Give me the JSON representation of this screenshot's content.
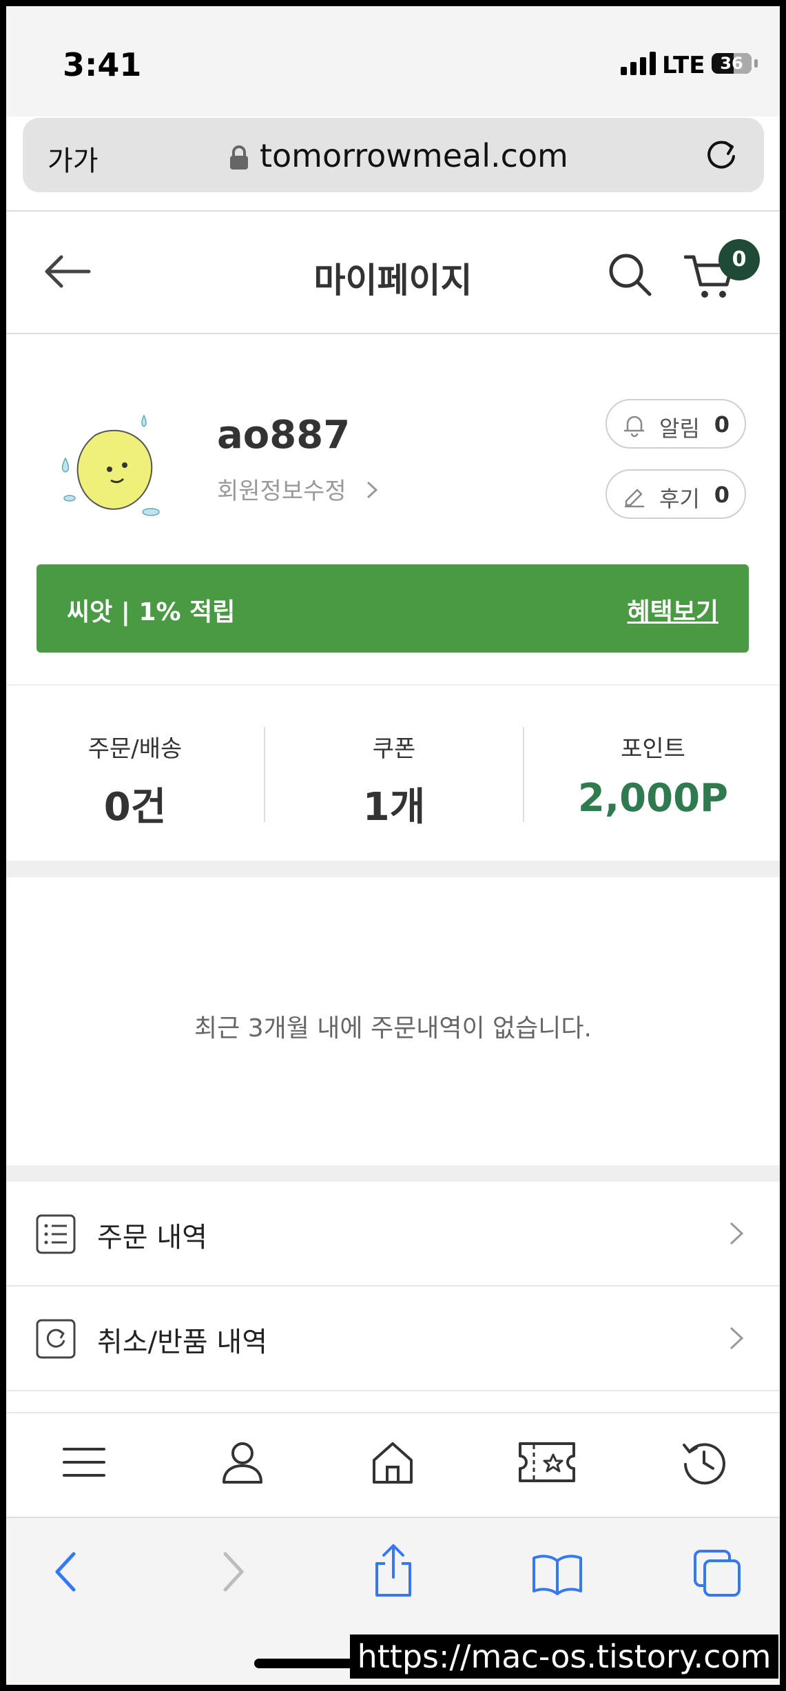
{
  "status_bar": {
    "time": "3:41",
    "network": "LTE",
    "battery": "36"
  },
  "browser": {
    "text_size_label": "가가",
    "url": "tomorrowmeal.com"
  },
  "header": {
    "title": "마이페이지",
    "cart_count": "0"
  },
  "profile": {
    "username": "ao887",
    "edit_label": "회원정보수정",
    "notifications": {
      "label": "알림",
      "count": "0"
    },
    "reviews": {
      "label": "후기",
      "count": "0"
    }
  },
  "grade": {
    "text": "씨앗 | 1% 적립",
    "benefit_label": "혜택보기",
    "color": "#4a9a43"
  },
  "stats": [
    {
      "label": "주문/배송",
      "value": "0건"
    },
    {
      "label": "쿠폰",
      "value": "1개"
    },
    {
      "label": "포인트",
      "value": "2,000P"
    }
  ],
  "orders": {
    "empty_message": "최근 3개월 내에 주문내역이 없습니다."
  },
  "menu": [
    {
      "label": "주문 내역",
      "icon": "list-icon"
    },
    {
      "label": "취소/반품 내역",
      "icon": "refresh-icon"
    }
  ],
  "bottom_nav": [
    "menu-icon",
    "user-icon",
    "home-icon",
    "ticket-icon",
    "history-icon"
  ],
  "safari_toolbar": [
    "back-icon",
    "forward-icon",
    "share-icon",
    "bookmarks-icon",
    "tabs-icon"
  ],
  "watermark": "https://mac-os.tistory.com",
  "colors": {
    "accent_green": "#2f7a4f",
    "badge": "#1e4a36",
    "safari_blue": "#3478f6"
  }
}
